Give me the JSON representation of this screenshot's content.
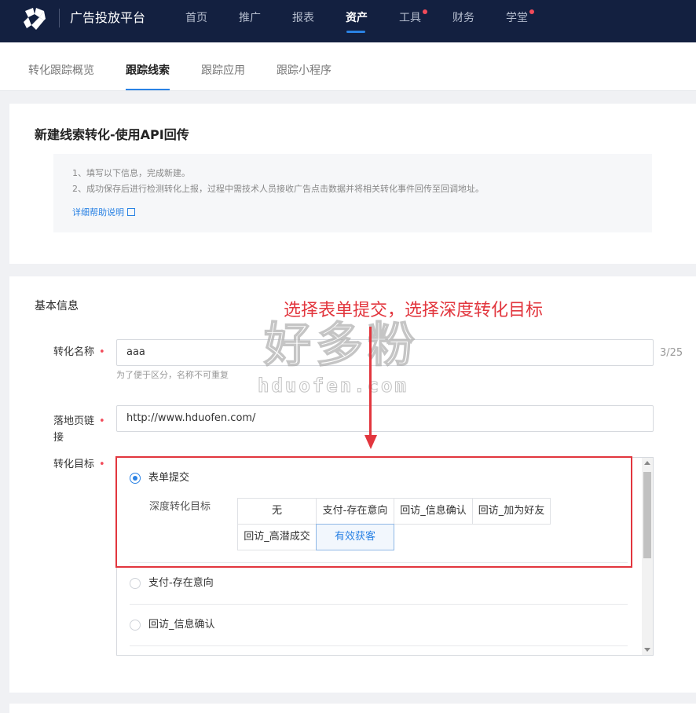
{
  "colors": {
    "nav_bg": "#132040",
    "accent": "#2a82e4",
    "annotation_red": "#e2363e",
    "required_star": "#f24b5a"
  },
  "topnav": {
    "logo_icon": "brand-logo-icon",
    "brand": "广告投放平台",
    "items": [
      {
        "label": "首页",
        "active": false,
        "dot": false
      },
      {
        "label": "推广",
        "active": false,
        "dot": false
      },
      {
        "label": "报表",
        "active": false,
        "dot": false
      },
      {
        "label": "资产",
        "active": true,
        "dot": false
      },
      {
        "label": "工具",
        "active": false,
        "dot": true
      },
      {
        "label": "财务",
        "active": false,
        "dot": false
      },
      {
        "label": "学堂",
        "active": false,
        "dot": true
      }
    ]
  },
  "subtabs": [
    {
      "label": "转化跟踪概览",
      "active": false
    },
    {
      "label": "跟踪线索",
      "active": true
    },
    {
      "label": "跟踪应用",
      "active": false
    },
    {
      "label": "跟踪小程序",
      "active": false
    }
  ],
  "intro": {
    "title": "新建线索转化-使用API回传",
    "tips": [
      "1、填写以下信息，完成新建。",
      "2、成功保存后进行检测转化上报，过程中需技术人员接收广告点击数据并将相关转化事件回传至回调地址。"
    ],
    "help_link": "详细帮助说明",
    "help_icon": "external-link-icon"
  },
  "form": {
    "section_title": "基本信息",
    "required_mark": "•",
    "name": {
      "label": "转化名称",
      "value": "aaa",
      "counter": "3/25",
      "hint": "为了便于区分，名称不可重复"
    },
    "landing": {
      "label_line1": "落地页链",
      "label_line2": "接",
      "value": "http://www.hduofen.com/"
    },
    "target": {
      "label": "转化目标",
      "options": [
        {
          "label": "表单提交",
          "selected": true
        },
        {
          "label": "支付-存在意向",
          "selected": false
        },
        {
          "label": "回访_信息确认",
          "selected": false
        }
      ],
      "deep_label": "深度转化目标",
      "deep_options_row1": [
        "无",
        "支付-存在意向",
        "回访_信息确认",
        "回访_加为好友"
      ],
      "deep_options_row2": [
        "回访_高潜成交",
        "有效获客"
      ],
      "deep_selected": "有效获客"
    }
  },
  "annotation": {
    "text": "选择表单提交，选择深度转化目标"
  },
  "watermark": {
    "big": "好多粉",
    "url": "hduofen.com"
  }
}
